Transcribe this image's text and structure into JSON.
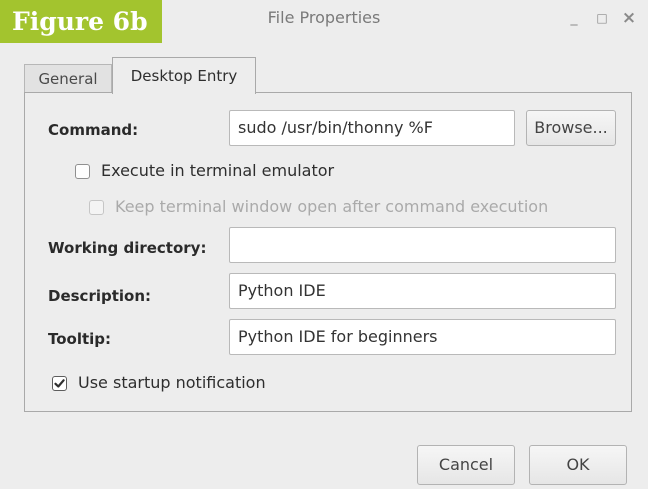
{
  "figure_label": "Figure 6b",
  "window": {
    "title": "File Properties",
    "controls": {
      "minimize": "_",
      "maximize": "□",
      "close": "×"
    }
  },
  "tabs": [
    {
      "label": "General",
      "active": false
    },
    {
      "label": "Desktop Entry",
      "active": true
    }
  ],
  "form": {
    "command": {
      "label": "Command:",
      "value": "sudo /usr/bin/thonny %F",
      "browse_label": "Browse..."
    },
    "execute_in_terminal": {
      "label": "Execute in terminal emulator",
      "checked": false
    },
    "keep_terminal_open": {
      "label": "Keep terminal window open after command execution",
      "checked": false,
      "disabled": true
    },
    "working_directory": {
      "label": "Working directory:",
      "value": ""
    },
    "description": {
      "label": "Description:",
      "value": "Python IDE"
    },
    "tooltip": {
      "label": "Tooltip:",
      "value": "Python IDE for beginners"
    },
    "startup_notification": {
      "label": "Use startup notification",
      "checked": true
    }
  },
  "buttons": {
    "cancel": "Cancel",
    "ok": "OK"
  }
}
